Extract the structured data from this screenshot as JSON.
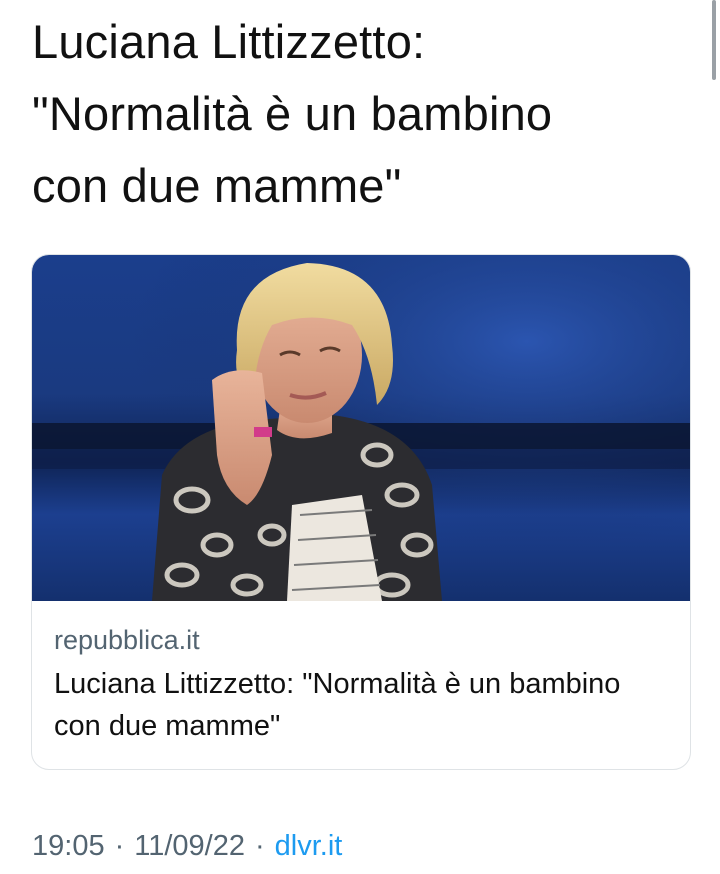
{
  "tweet": {
    "text": "Luciana Littizzetto:\n\"Normalità è un bambino\ncon due mamme\""
  },
  "card": {
    "domain": "repubblica.it",
    "title": "Luciana Littizzetto: \"Normalità è un bambino con due mamme\""
  },
  "meta": {
    "time": "19:05",
    "date": "11/09/22",
    "source": "dlvr.it",
    "separator": "·"
  },
  "colors": {
    "text": "#111111",
    "secondary": "#536471",
    "link": "#1d9bf0",
    "card_border": "#dfe3e6",
    "photo_background": "#1b3e8c"
  }
}
